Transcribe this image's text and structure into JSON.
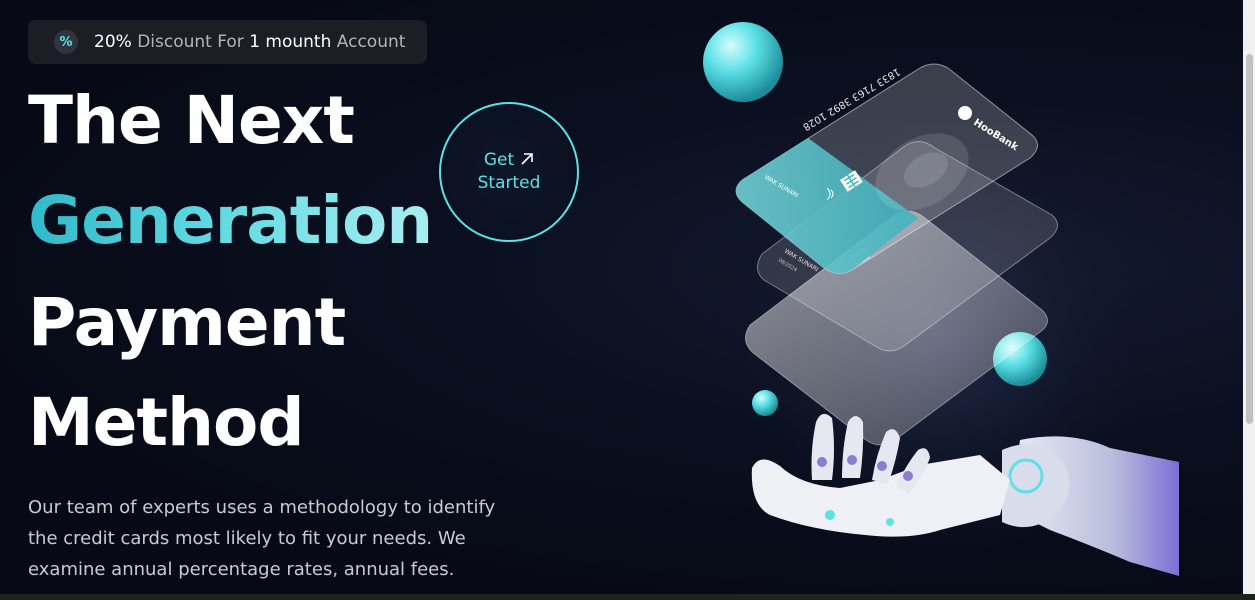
{
  "discount": {
    "icon": "percent-icon",
    "percent": "20%",
    "text_middle": " Discount For ",
    "highlight": "1 mounth",
    "text_end": " Account"
  },
  "hero": {
    "line1": "The Next",
    "line2": "Generation",
    "line3": "Payment",
    "line4": "Method",
    "description": "Our team of experts uses a methodology to identify the credit cards most likely to fit your needs. We examine annual percentage rates, annual fees."
  },
  "cta": {
    "line1": "Get",
    "line2": "Started",
    "icon": "arrow-up-right-icon"
  },
  "card": {
    "number": "1833 7163 3892 1028",
    "brand": "HooBank",
    "holder": "WAK SUNARI",
    "expiry": "08/2024"
  },
  "colors": {
    "accent": "#5ce1e6",
    "background": "#00040f"
  }
}
